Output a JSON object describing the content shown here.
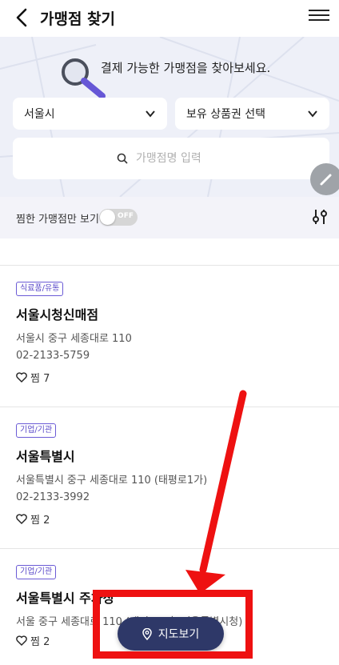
{
  "header": {
    "title": "가맹점 찾기"
  },
  "hero": {
    "message": "결제 가능한 가맹점을 찾아보세요."
  },
  "filters": {
    "city": "서울시",
    "voucher": "보유 상품권 선택",
    "search_placeholder": "가맹점명 입력"
  },
  "favorites_filter": {
    "label": "찜한 가맹점만 보기",
    "toggle_state": "OFF"
  },
  "stores": [
    {
      "category": "식료품/유통",
      "name": "서울시청신매점",
      "address": "서울시 중구 세종대로 110",
      "phone": "02-2133-5759",
      "likes": "찜 7"
    },
    {
      "category": "기업/기관",
      "name": "서울특별시",
      "address": "서울특별시 중구 세종대로 110 (태평로1가)",
      "phone": "02-2133-3992",
      "likes": "찜 2"
    },
    {
      "category": "기업/기관",
      "name": "서울특별시 주차장",
      "address": "서울 중구 세종대로 110 (태평로1가, 서울특별시청)",
      "likes": "찜 2"
    }
  ],
  "map_button": {
    "label": "지도보기"
  },
  "colors": {
    "accent": "#2e3868",
    "annotation": "#ee1111",
    "badge": "#5a49c9"
  }
}
